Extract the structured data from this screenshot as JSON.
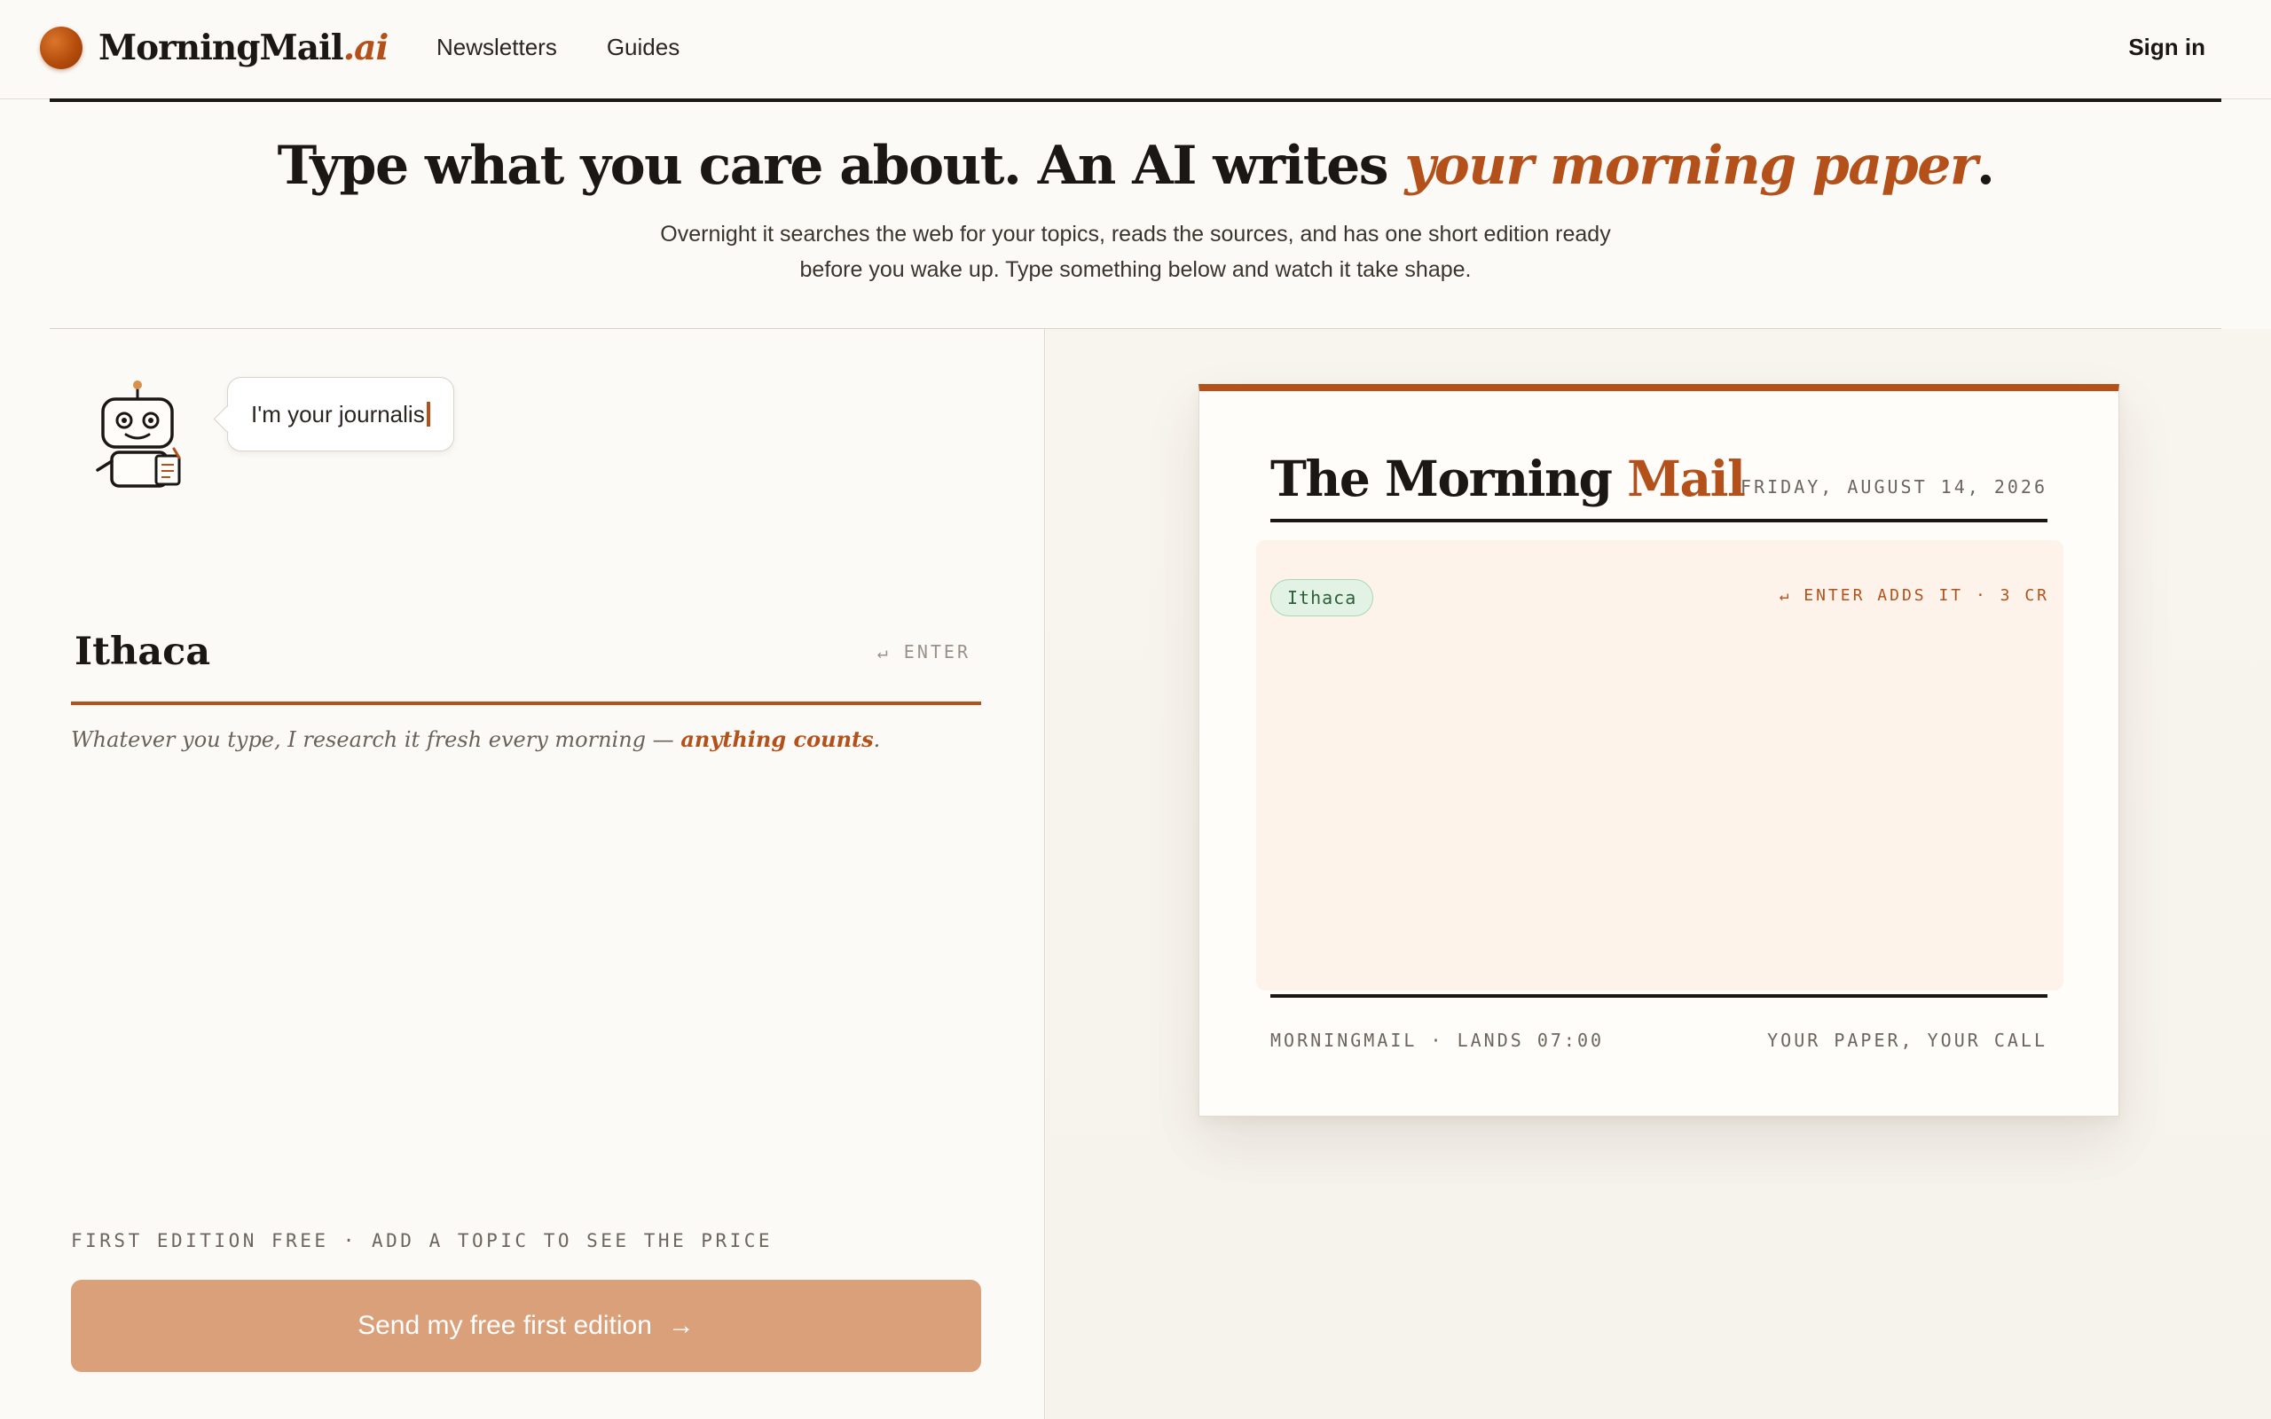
{
  "header": {
    "logo_main": "MorningMail",
    "logo_suffix": ".ai",
    "nav": [
      "Newsletters",
      "Guides"
    ],
    "signin": "Sign in"
  },
  "hero": {
    "title_main": "Type what you care about. An AI writes ",
    "title_accent": "your morning paper",
    "title_end": ".",
    "subtitle_line1": "Overnight it searches the web for your topics, reads the sources, and has one short edition ready",
    "subtitle_line2": "before you wake up. Type something below and watch it take shape."
  },
  "composer": {
    "bubble_text": "I'm your journalis",
    "topic_value": "Ithaca",
    "enter_hint": "↵ ENTER",
    "helper_text": "Whatever you type, I research it fresh every morning — ",
    "helper_link": "anything counts",
    "helper_end": ".",
    "price_note": "FIRST EDITION FREE · ADD A TOPIC TO SEE THE PRICE",
    "cta_label": "Send my free first edition",
    "cta_arrow": "→"
  },
  "paper": {
    "title_main": "The Morning ",
    "title_accent": "Mail",
    "date": "FRIDAY, AUGUST 14, 2026",
    "chip": "Ithaca",
    "add_hint": "↵ ENTER ADDS IT · 3 CR",
    "footer_left": "MORNINGMAIL · LANDS 07:00",
    "footer_right": "YOUR PAPER, YOUR CALL"
  },
  "colors": {
    "accent": "#b4501a",
    "cta": "#d9a07a",
    "chip_bg": "#e2f3e5",
    "background": "#fcfaf6"
  },
  "icons": [
    "logo-orb-icon",
    "robot-journalist-icon",
    "arrow-right-icon"
  ]
}
